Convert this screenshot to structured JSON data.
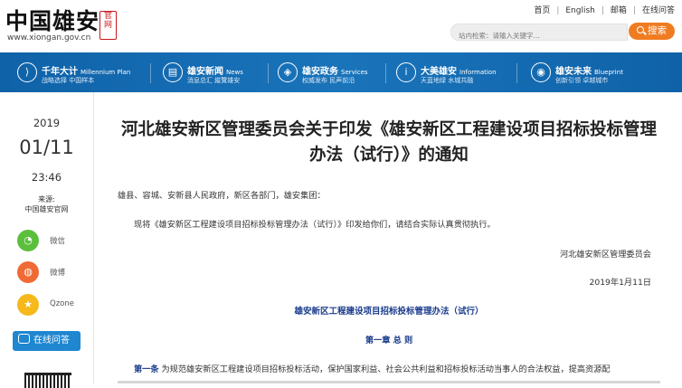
{
  "header": {
    "logo_text": "中国雄安",
    "logo_seal": "官网",
    "logo_url": "www.xiongan.gov.cn",
    "top_links": [
      "首页",
      "English",
      "邮箱",
      "在线问答"
    ],
    "search_placeholder": "站内检索：请输入关键字...",
    "search_button": "搜索",
    "accent_color": "#f07c22"
  },
  "nav": {
    "background_color": "#1466ad",
    "items": [
      {
        "icon": "chevron-icon",
        "icon_glyph": "⟩",
        "title": "千年大计",
        "title_en": "Millennium Plan",
        "sub": "战略选择 中国样本"
      },
      {
        "icon": "newspaper-icon",
        "icon_glyph": "▤",
        "title": "雄安新闻",
        "title_en": "News",
        "sub": "消息总汇 縱覽雄安"
      },
      {
        "icon": "services-icon",
        "icon_glyph": "◈",
        "title": "雄安政务",
        "title_en": "Services",
        "sub": "权威发布 民声前沿"
      },
      {
        "icon": "info-icon",
        "icon_glyph": "i",
        "title": "大美雄安",
        "title_en": "Information",
        "sub": "天蓝地绿 水城共融"
      },
      {
        "icon": "pin-icon",
        "icon_glyph": "◉",
        "title": "雄安未来",
        "title_en": "Blueprint",
        "sub": "创新引领 卓越城市"
      }
    ]
  },
  "sidebar": {
    "year": "2019",
    "date": "01/11",
    "time": "23:46",
    "source_label": "来源:",
    "source_value": "中国雄安官网",
    "share": [
      {
        "icon": "wechat-icon",
        "glyph": "◔",
        "label": "微信"
      },
      {
        "icon": "weibo-icon",
        "glyph": "◍",
        "label": "微博"
      },
      {
        "icon": "qzone-icon",
        "glyph": "★",
        "label": "Qzone"
      }
    ],
    "online_button": "在线问答"
  },
  "article": {
    "title": "河北雄安新区管理委员会关于印发《雄安新区工程建设项目招标投标管理办法（试行）》的通知",
    "greeting": "雄县、容城、安新县人民政府，新区各部门，雄安集团：",
    "body": "现将《雄安新区工程建设项目招标投标管理办法（试行）》印发给你们，请结合实际认真贯彻执行。",
    "signature": "河北雄安新区管理委员会",
    "date": "2019年1月11日",
    "doc_title": "雄安新区工程建设项目招标投标管理办法（试行）",
    "chapter": "第一章 总 则",
    "article1_label": "第一条",
    "article1_text": "为规范雄安新区工程建设项目招标投标活动，保护国家利益、社会公共利益和招标投标活动当事人的合法权益，提高资源配"
  }
}
